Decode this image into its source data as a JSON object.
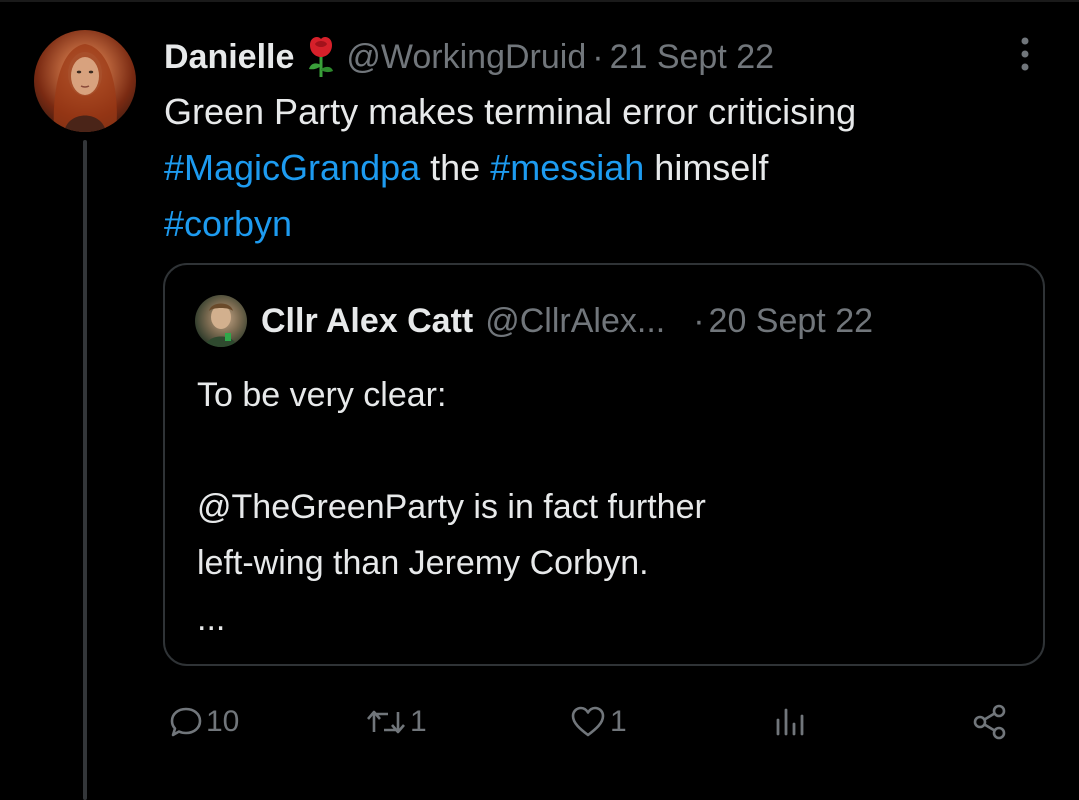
{
  "tweet": {
    "author_name": "Danielle",
    "handle": "@WorkingDruid",
    "separator": "·",
    "date": "21 Sept 22",
    "text": {
      "line1": "Green Party makes terminal error criticising",
      "hashtag1": "#MagicGrandpa",
      "word_the": " the ",
      "hashtag2": "#messiah",
      "word_himself": " himself",
      "hashtag3": "#corbyn"
    },
    "icons": {
      "rose": "rose-emoji-icon",
      "more": "more-vertical-icon"
    }
  },
  "quote": {
    "author_name": "Cllr Alex Catt",
    "handle": "@CllrAlex...",
    "separator": "·",
    "date": "20 Sept 22",
    "lines": [
      "To be very clear:",
      "",
      "@TheGreenParty is in fact further",
      "left-wing than Jeremy Corbyn.",
      "..."
    ]
  },
  "actions": {
    "reply_count": "10",
    "retweet_count": "1",
    "like_count": "1",
    "icons": [
      "reply-icon",
      "retweet-icon",
      "like-icon",
      "views-icon",
      "share-icon"
    ]
  },
  "colors": {
    "background": "#000000",
    "text": "#e7e9ea",
    "muted": "#71767b",
    "link": "#1d9bf0",
    "border": "#2f3336"
  }
}
